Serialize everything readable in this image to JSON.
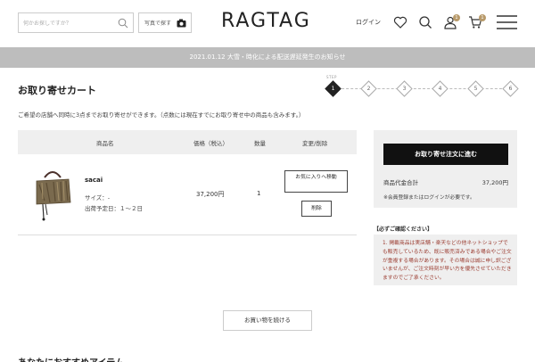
{
  "header": {
    "search_placeholder": "何かお探しですか？",
    "photo_search_label": "写真で探す",
    "logo": "RAGTAG",
    "login_label": "ログイン",
    "icons": [
      "heart-icon",
      "search-icon",
      "user-icon",
      "cart-icon",
      "menu-icon"
    ],
    "user_badge": "1",
    "cart_badge": "1"
  },
  "notice": {
    "text": "2021.01.12 大雪・時化による配送遅延発生のお知らせ"
  },
  "page": {
    "title": "お取り寄せカート",
    "intro": "ご希望の店舗へ同時に3点までお取り寄せができます。（点数には現在すでにお取り寄せ中の商品も含みます。）"
  },
  "steps": {
    "label": "STEP",
    "items": [
      "1",
      "2",
      "3",
      "4",
      "5",
      "6"
    ],
    "current": 1
  },
  "cart": {
    "columns": [
      "商品名",
      "価格（税込）",
      "数量",
      "変更/削除"
    ],
    "items": [
      {
        "name": "sacai",
        "size": "サイズ：-",
        "shipping": "出荷予定日：１～２日",
        "price": "37,200円",
        "quantity": "1",
        "favorite_label": "お気に入りへ移動",
        "delete_label": "削除"
      }
    ]
  },
  "summary": {
    "order_button": "お取り寄せ注文に進む",
    "total_label": "商品代金合計",
    "total_value": "37,200円",
    "note": "※会員登録またはログインが必要です。"
  },
  "confirm": {
    "title": "【必ずご確認ください】",
    "text": "1. 掲載商品は実店舗・楽天などの他ネットショップでも販売しているため、既に販売済みである場合やご注文が重複する場合があります。その場合は誠に申し訳ございませんが、ご注文時刻が早い方を優先させていただきますのでご了承ください。"
  },
  "continue_label": "お買い物を続ける",
  "recommend_title": "あなたにおすすめアイテム",
  "colors": {
    "notice_bg": "#bdbdbd",
    "accent_dark": "#111111",
    "badge": "#b89a6a",
    "warning_text": "#9a3a2e"
  }
}
